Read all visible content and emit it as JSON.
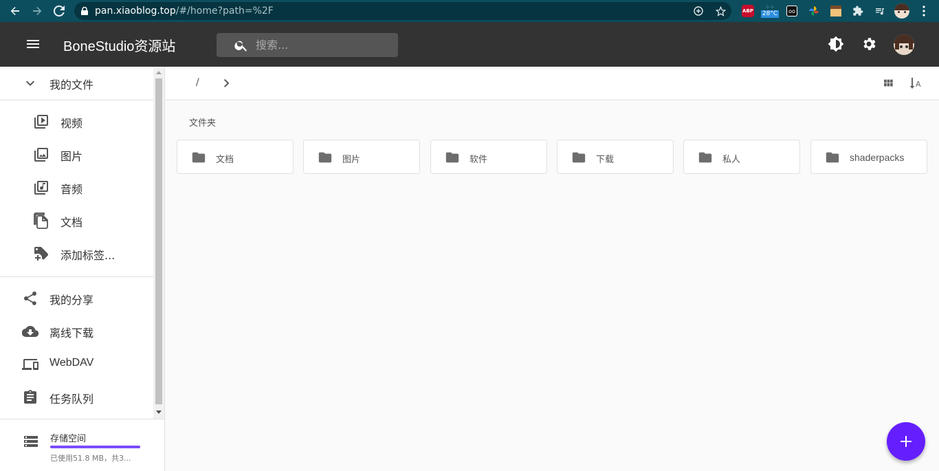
{
  "browser": {
    "url_host": "pan.xiaoblog.top",
    "url_path": "/#/home?path=%2F",
    "extensions": {
      "abp": "ABP",
      "weather": "28°C"
    }
  },
  "appbar": {
    "title": "BoneStudio资源站",
    "search_placeholder": "搜索..."
  },
  "sidebar": {
    "my_files": "我的文件",
    "categories": [
      "视频",
      "图片",
      "音频",
      "文档",
      "添加标签..."
    ],
    "items": [
      "我的分享",
      "离线下载",
      "WebDAV",
      "任务队列"
    ],
    "storage_title": "存储空间",
    "storage_usage": "已使用51.8 MB，共3...",
    "storage_fraction": 1.0
  },
  "breadcrumb": {
    "root": "/"
  },
  "main": {
    "section_title": "文件夹",
    "folders": [
      "文档",
      "图片",
      "软件",
      "下载",
      "私人",
      "shaderpacks"
    ]
  },
  "colors": {
    "appbar": "#333333",
    "accent": "#651fff",
    "browser": "#0c4e5e"
  }
}
